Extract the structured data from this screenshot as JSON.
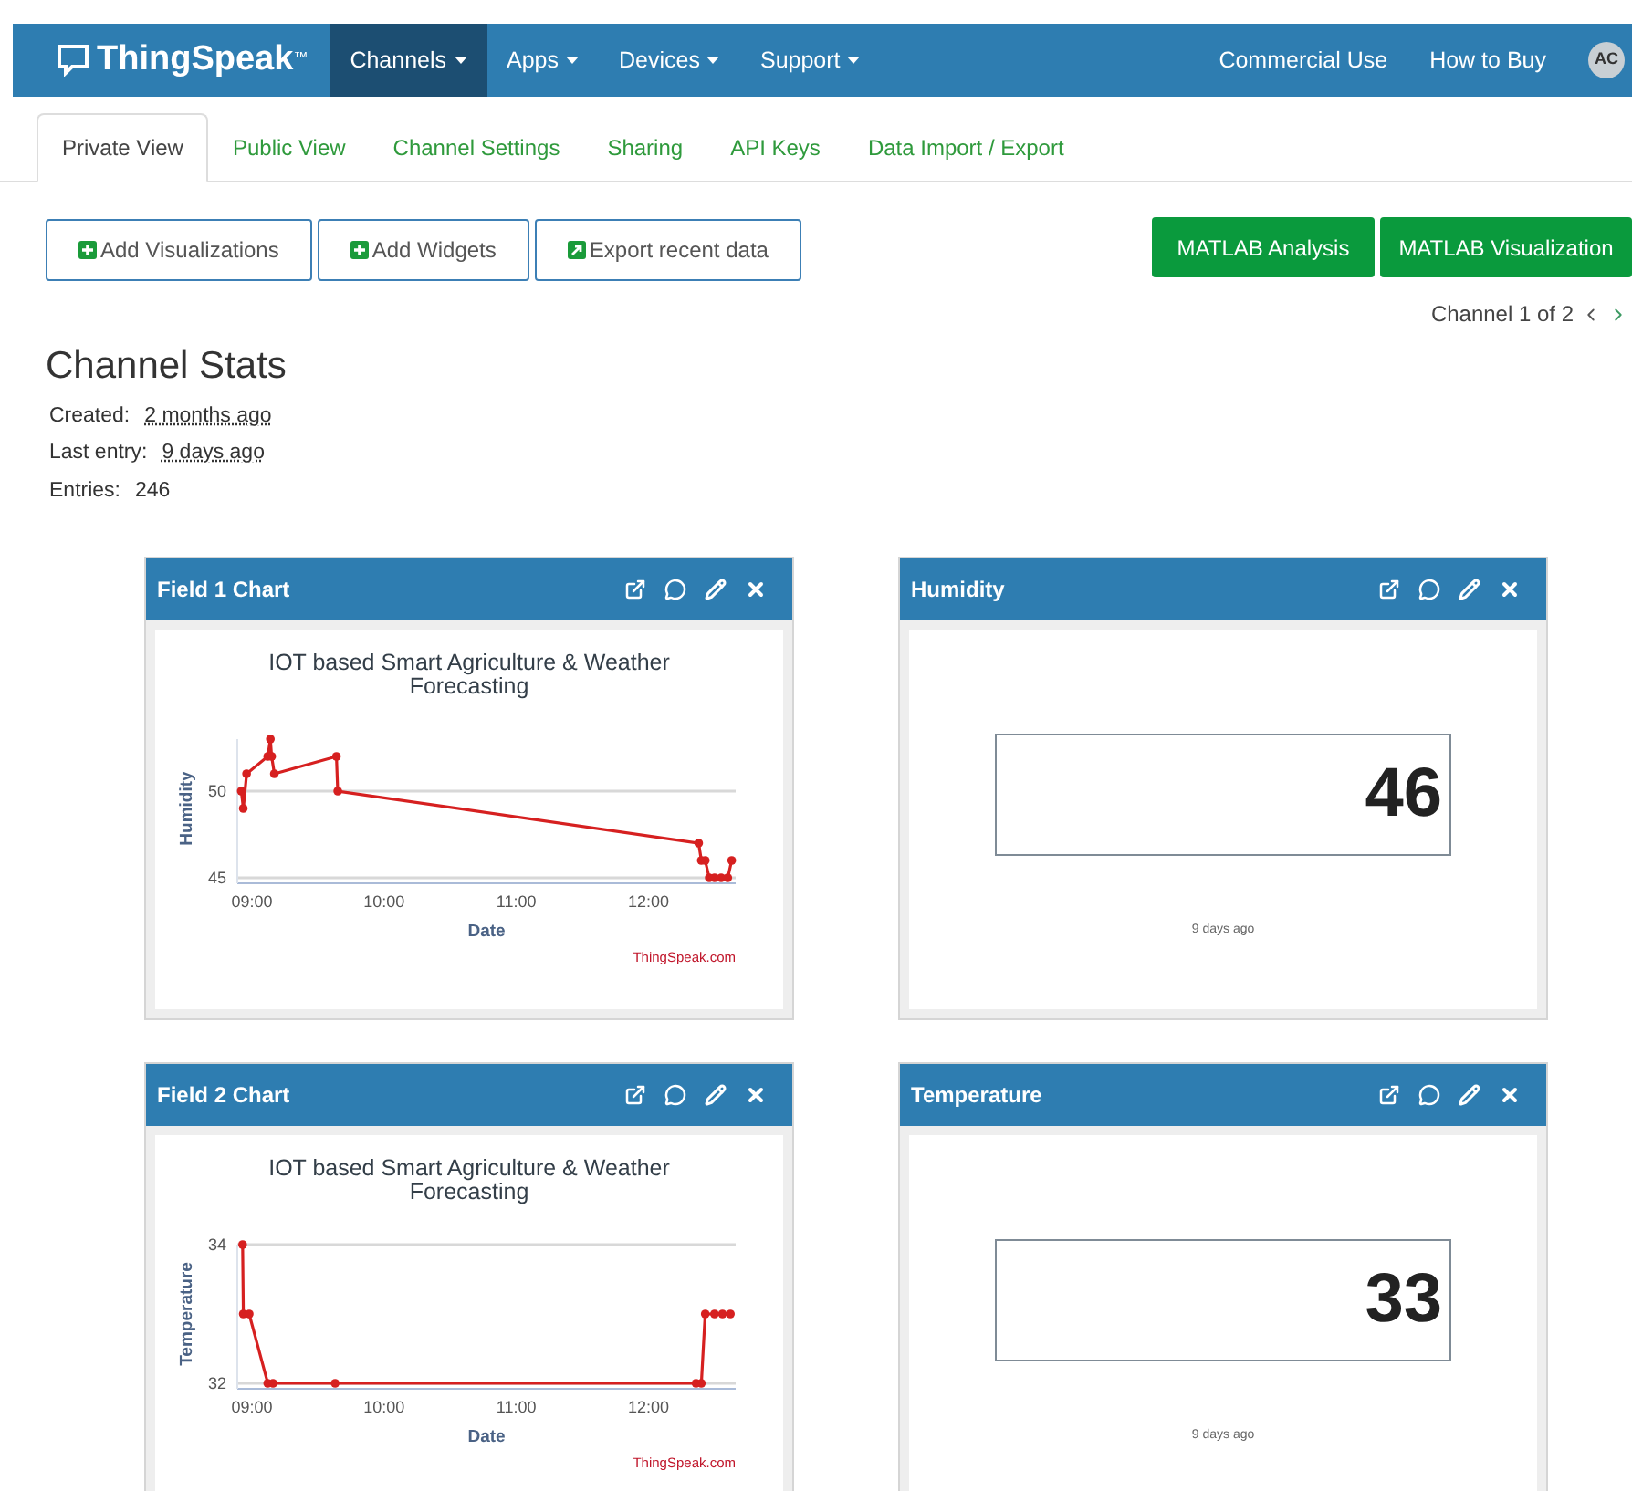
{
  "brand": {
    "name": "ThingSpeak",
    "mark": "™"
  },
  "nav": [
    {
      "label": "Channels",
      "has_menu": true,
      "selected": true
    },
    {
      "label": "Apps",
      "has_menu": true,
      "selected": false
    },
    {
      "label": "Devices",
      "has_menu": true,
      "selected": false
    },
    {
      "label": "Support",
      "has_menu": true,
      "selected": false
    }
  ],
  "nav_right": [
    "Commercial Use",
    "How to Buy"
  ],
  "avatar": "AC",
  "tabs": [
    {
      "label": "Private View",
      "selected": true
    },
    {
      "label": "Public View",
      "selected": false
    },
    {
      "label": "Channel Settings",
      "selected": false
    },
    {
      "label": "Sharing",
      "selected": false
    },
    {
      "label": "API Keys",
      "selected": false
    },
    {
      "label": "Data Import / Export",
      "selected": false
    }
  ],
  "actions": [
    {
      "label": "Add Visualizations",
      "kind": "add"
    },
    {
      "label": "Add Widgets",
      "kind": "add"
    },
    {
      "label": "Export recent data",
      "kind": "export"
    }
  ],
  "matlab_buttons": [
    "MATLAB Analysis",
    "MATLAB Visualization"
  ],
  "pager": "Channel 1 of 2",
  "heading": "Channel Stats",
  "stats": [
    {
      "label": "Created:",
      "value": "2 months ago"
    },
    {
      "label": "Last entry:",
      "value": "9 days ago"
    },
    {
      "label": "Entries:",
      "value": "246"
    }
  ],
  "cards": [
    {
      "kind": "chart",
      "title": "Field 1 Chart",
      "credit": "ThingSpeak.com",
      "chart_data": {
        "type": "line",
        "title": "IOT based Smart Agriculture & Weather Forecasting",
        "xlabel": "Date",
        "ylabel": "Humidity",
        "x": [
          8.92,
          8.935,
          8.96,
          9.12,
          9.14,
          9.15,
          9.17,
          9.64,
          9.65,
          12.38,
          12.4,
          12.43,
          12.46,
          12.5,
          12.55,
          12.6,
          12.63
        ],
        "series": [
          {
            "color": "#d62020",
            "marker": "circle",
            "values": [
              50,
              49,
              51,
              52,
              53,
              52,
              51,
              52,
              50,
              47,
              46,
              46,
              45,
              45,
              45,
              45,
              46
            ]
          }
        ],
        "xlim": [
          8.89,
          12.66
        ],
        "xticks": [
          {
            "value": 9,
            "label": "09:00"
          },
          {
            "value": 10,
            "label": "10:00"
          },
          {
            "value": 11,
            "label": "11:00"
          },
          {
            "value": 12,
            "label": "12:00"
          }
        ],
        "ylim": [
          45,
          53
        ],
        "yticks": [
          45,
          50
        ]
      }
    },
    {
      "kind": "numeric",
      "title": "Humidity",
      "value": "46",
      "time": "9 days ago"
    },
    {
      "kind": "chart",
      "title": "Field 2 Chart",
      "credit": "ThingSpeak.com",
      "chart_data": {
        "type": "line",
        "title": "IOT based Smart Agriculture & Weather Forecasting",
        "xlabel": "Date",
        "ylabel": "Temperature",
        "x": [
          8.93,
          8.935,
          8.98,
          9.12,
          9.16,
          9.63,
          12.36,
          12.4,
          12.43,
          12.5,
          12.56,
          12.62
        ],
        "series": [
          {
            "color": "#d62020",
            "marker": "circle",
            "values": [
              34,
              33,
              33,
              32,
              32,
              32,
              32,
              32,
              33,
              33,
              33,
              33
            ]
          }
        ],
        "xlim": [
          8.89,
          12.66
        ],
        "xticks": [
          {
            "value": 9,
            "label": "09:00"
          },
          {
            "value": 10,
            "label": "10:00"
          },
          {
            "value": 11,
            "label": "11:00"
          },
          {
            "value": 12,
            "label": "12:00"
          }
        ],
        "ylim": [
          32,
          34
        ],
        "yticks": [
          32,
          34
        ]
      }
    },
    {
      "kind": "numeric",
      "title": "Temperature",
      "value": "33",
      "time": "9 days ago"
    }
  ]
}
